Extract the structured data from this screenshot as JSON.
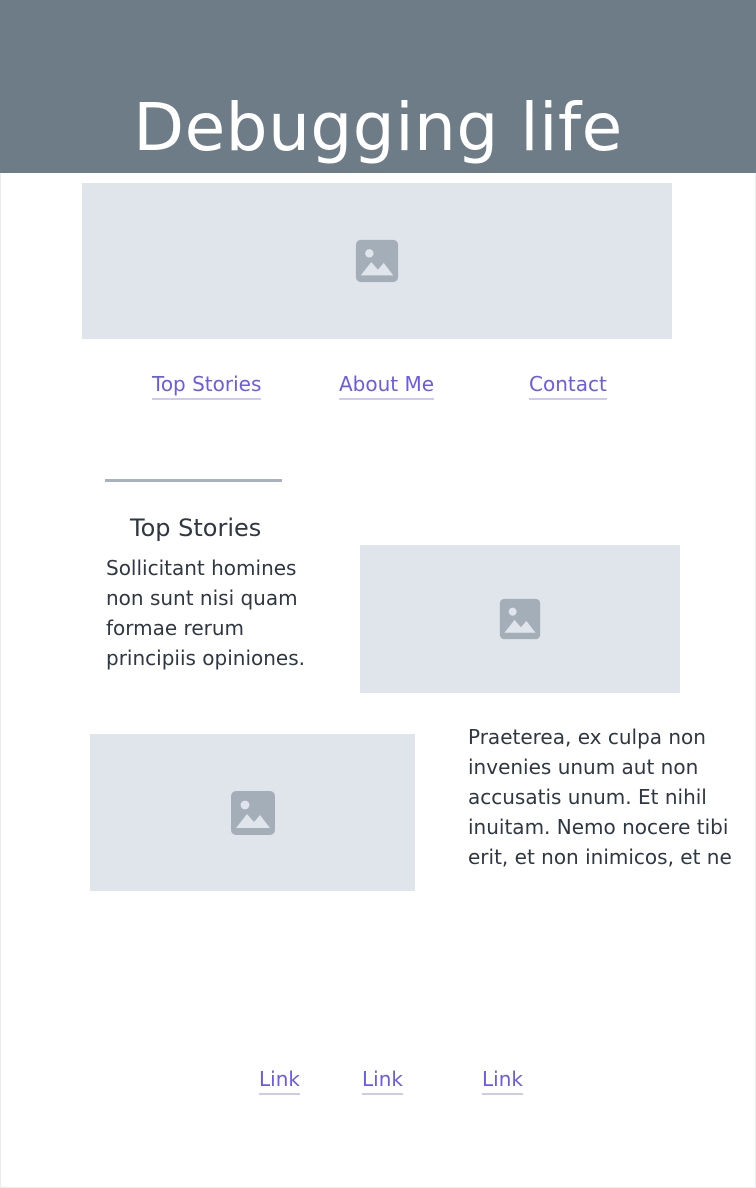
{
  "header": {
    "title": "Debugging life",
    "background": "#6e7c88"
  },
  "hero_image": {
    "icon": "image-icon"
  },
  "nav": {
    "items": [
      {
        "label": "Top Stories"
      },
      {
        "label": "About Me"
      },
      {
        "label": "Contact"
      }
    ]
  },
  "section": {
    "title": "Top Stories",
    "paragraphs": [
      "Sollicitant homines non sunt nisi quam formae rerum principiis opiniones.",
      "Praeterea, ex culpa non invenies unum aut non accusatis unum. Et nihil inuitam. Nemo nocere tibi erit, et non inimicos, et ne"
    ]
  },
  "footer": {
    "links": [
      {
        "label": "Link"
      },
      {
        "label": "Link"
      },
      {
        "label": "Link"
      }
    ]
  },
  "colors": {
    "link": "#6b5ce7",
    "placeholder": "#e0e4eb",
    "icon": "#a3aeb8",
    "text": "#2f3742"
  }
}
